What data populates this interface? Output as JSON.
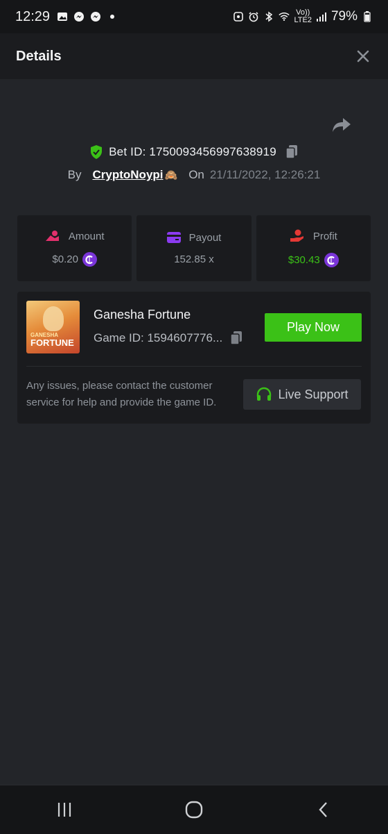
{
  "status_bar": {
    "time": "12:29",
    "battery_percent": "79%",
    "network_label_top": "Vo))",
    "network_label_bottom": "LTE2",
    "icons": [
      "gallery-icon",
      "messenger-icon",
      "messenger-icon",
      "dot-icon",
      "alarm-icon",
      "bluetooth-icon",
      "wifi-icon",
      "signal-icon",
      "battery-icon"
    ]
  },
  "header": {
    "title": "Details"
  },
  "bet": {
    "bet_id_label": "Bet ID: 1750093456997638919",
    "by_label": "By",
    "username": "CryptoNoypi",
    "username_emoji": "🙈",
    "on_label": "On",
    "datetime": "21/11/2022, 12:26:21"
  },
  "stats": {
    "amount": {
      "label": "Amount",
      "value": "$0.20"
    },
    "payout": {
      "label": "Payout",
      "value": "152.85 x"
    },
    "profit": {
      "label": "Profit",
      "value": "$30.43"
    }
  },
  "game": {
    "name": "Ganesha Fortune",
    "game_id": "Game ID: 1594607776...",
    "thumb_title_top": "GANESHA",
    "thumb_title_bottom": "FORTUNE",
    "play_button": "Play Now"
  },
  "support": {
    "message": "Any issues, please contact the customer service for help and provide the game ID.",
    "button": "Live Support"
  },
  "colors": {
    "accent_green": "#3bc117",
    "coin_purple": "#7a35d8",
    "background": "#232529",
    "card": "#1a1b1e"
  }
}
